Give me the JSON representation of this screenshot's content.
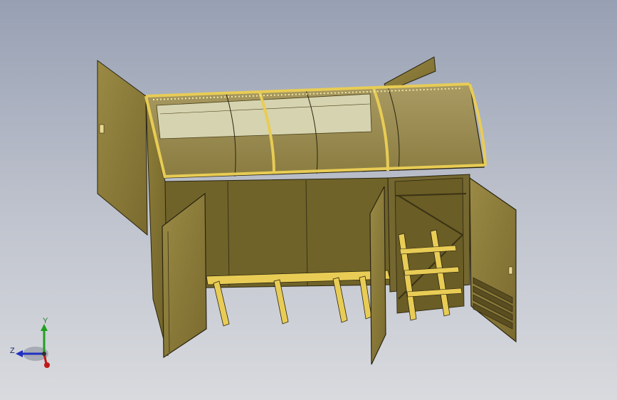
{
  "view": {
    "background_top": "#97a0b3",
    "background_bottom": "#d8dade",
    "model_color": "#8a7a35",
    "frame_color": "#e8cc55"
  },
  "triad": {
    "y_label": "Y",
    "z_label": "Z",
    "x_axis_color": "#c01818",
    "y_axis_color": "#20a020",
    "z_axis_color": "#2030c0",
    "icon": "coordinate-triad-icon"
  }
}
